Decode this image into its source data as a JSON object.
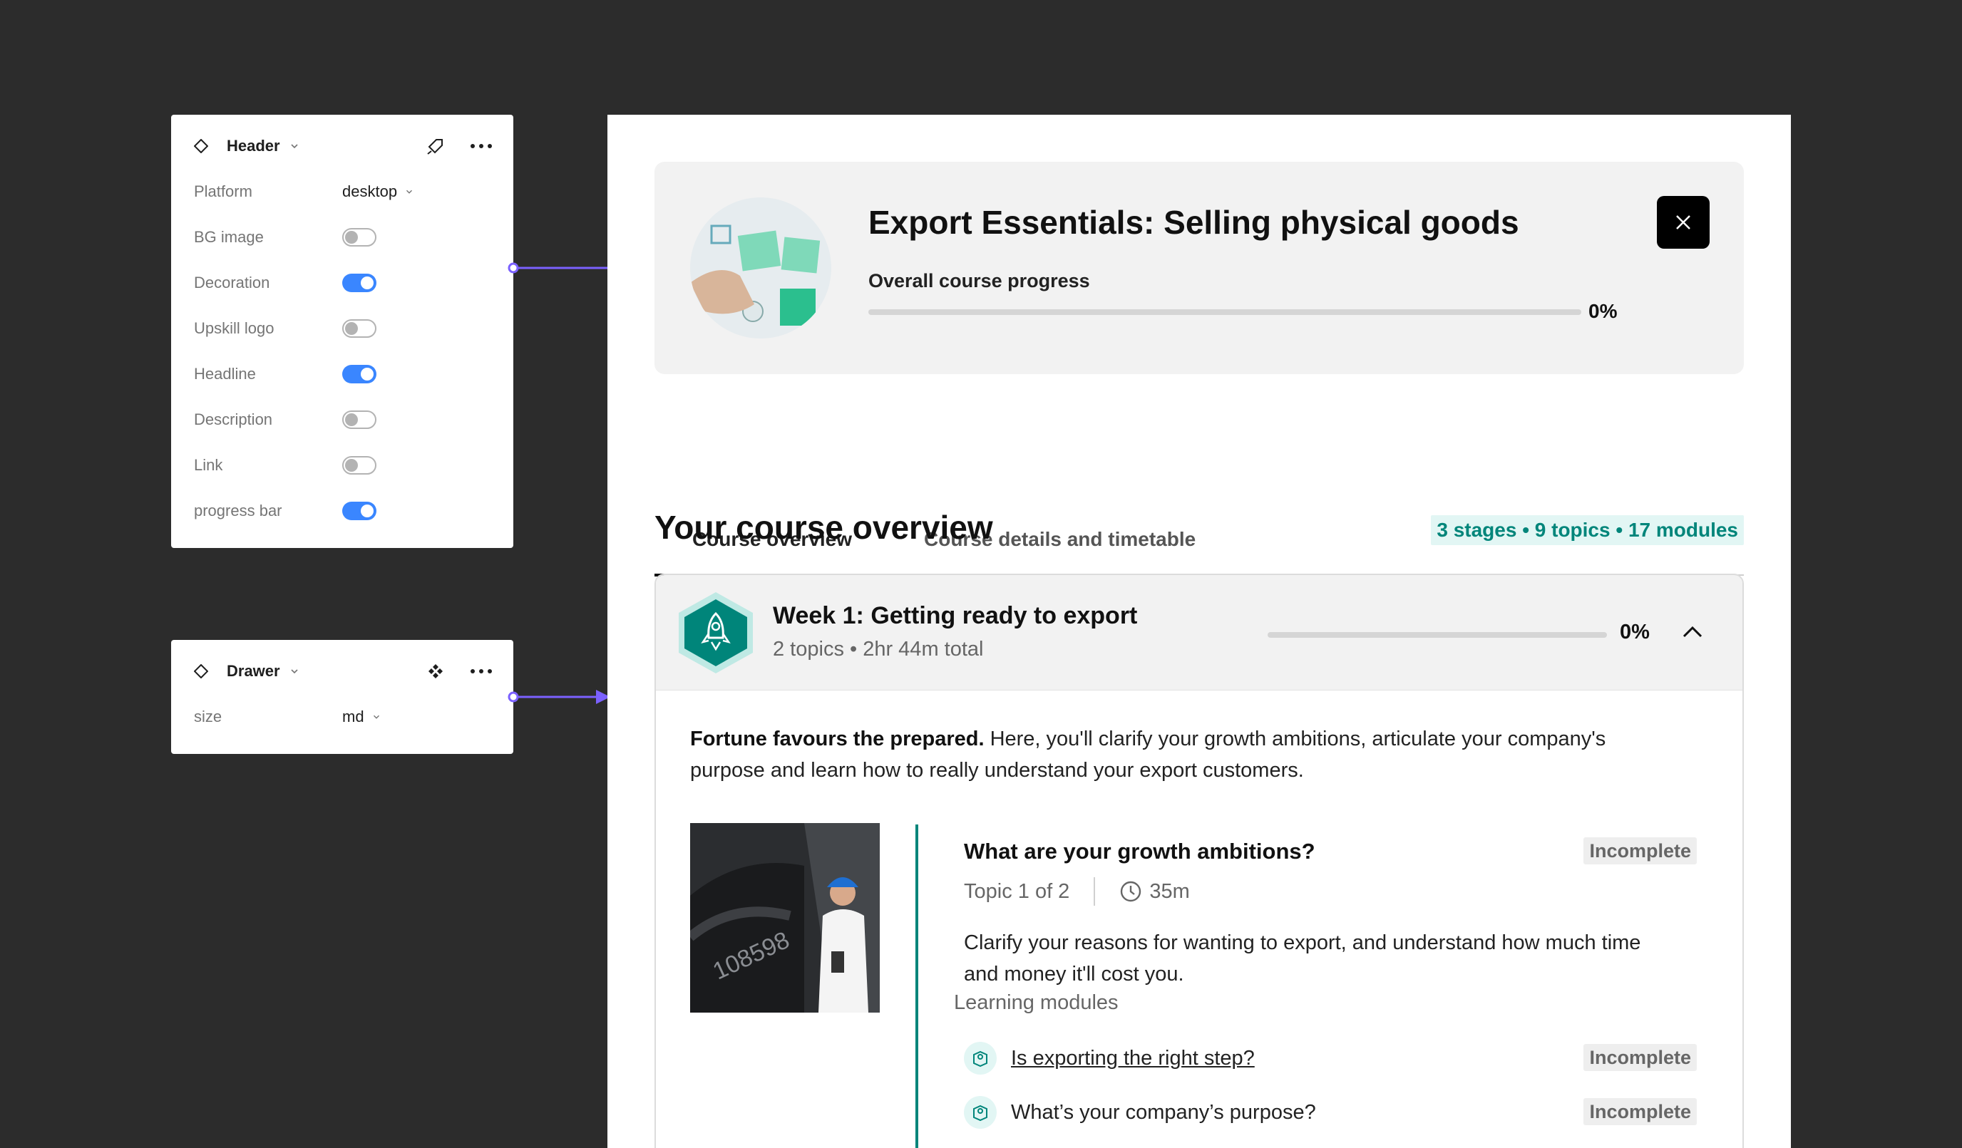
{
  "header_panel": {
    "title": "Header",
    "rows": [
      {
        "label": "Platform",
        "value": "desktop"
      },
      {
        "label": "BG image",
        "toggle": false
      },
      {
        "label": "Decoration",
        "toggle": true
      },
      {
        "label": "Upskill logo",
        "toggle": false
      },
      {
        "label": "Headline",
        "toggle": true
      },
      {
        "label": "Description",
        "toggle": false
      },
      {
        "label": "Link",
        "toggle": false
      },
      {
        "label": "progress bar",
        "toggle": true
      }
    ]
  },
  "drawer_panel": {
    "title": "Drawer",
    "rows": [
      {
        "label": "size",
        "value": "md"
      }
    ]
  },
  "drawer": {
    "hero": {
      "title": "Export Essentials: Selling physical goods",
      "progress_label": "Overall course progress",
      "progress_value": 0,
      "progress_text": "0%"
    },
    "tabs": [
      {
        "label": "Course overview",
        "active": true
      },
      {
        "label": "Course details and timetable",
        "active": false
      }
    ],
    "overview": {
      "title": "Your course overview",
      "summary": "3 stages • 9 topics • 17 modules"
    },
    "week": {
      "title": "Week 1: Getting ready to export",
      "meta": "2 topics • 2hr 44m total",
      "progress_value": 0,
      "progress_text": "0%",
      "intro_bold": "Fortune favours the prepared.",
      "intro_rest": " Here, you'll clarify your growth ambitions, articulate your company's purpose and learn how to really understand your export customers.",
      "topic": {
        "title": "What are your growth ambitions?",
        "status": "Incomplete",
        "position": "Topic 1 of 2",
        "duration": "35m",
        "description": "Clarify your reasons for wanting to export, and understand how much time and money it'll cost you.",
        "modules_label": "Learning modules",
        "modules": [
          {
            "title": "Is exporting the right step?",
            "status": "Incomplete"
          },
          {
            "title": "What’s your company’s purpose?",
            "status": "Incomplete"
          }
        ]
      }
    }
  },
  "colors": {
    "canvas": "#2c2c2c",
    "accent_teal": "#00857a",
    "toggle_on": "#3a86ff",
    "connector": "#7b61ff"
  }
}
